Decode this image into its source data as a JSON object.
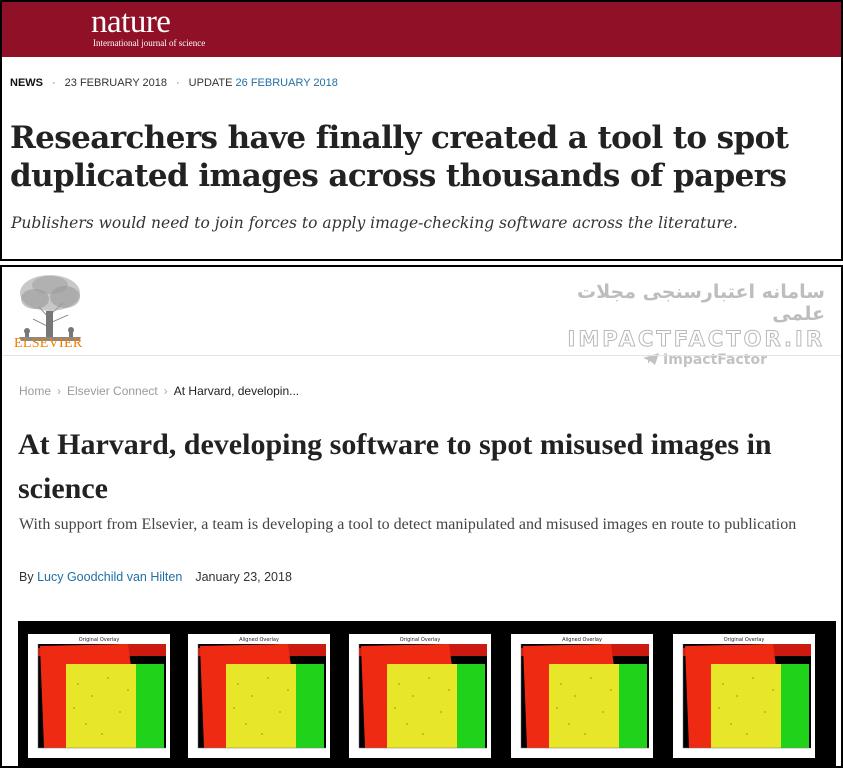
{
  "nature": {
    "logo": "nature",
    "tagline": "International journal of science",
    "section": "NEWS",
    "date": "23 FEBRUARY 2018",
    "update_label": "UPDATE",
    "update_date": "26 FEBRUARY 2018",
    "headline": "Researchers have finally created a tool to spot duplicated images across thousands of papers",
    "standfirst": "Publishers would need to join forces to apply image-checking software across the literature.",
    "brand_color": "#8f1027"
  },
  "elsevier": {
    "logo_text": "ELSEVIER",
    "brand_color": "#ef7d00",
    "watermark": {
      "persian": "سامانه اعتبارسنجی مجلات علمی",
      "site": "IMPACTFACTOR.IR",
      "handle": "ImpactFactor"
    },
    "breadcrumb": [
      "Home",
      "Elsevier Connect",
      "At Harvard, developin..."
    ],
    "headline": "At Harvard, developing software to spot misused images in science",
    "subheadline": "With support from Elsevier, a team is developing a tool to detect manipulated and misused images en route to publication",
    "byline_prefix": "By",
    "author": "Lucy Goodchild van Hilten",
    "date": "January 23, 2018",
    "link_color": "#1f6fa5",
    "overlay_titles": [
      "Original Overlay",
      "Aligned Overlay",
      "Original Overlay",
      "Aligned Overlay",
      "Original Overlay"
    ]
  }
}
